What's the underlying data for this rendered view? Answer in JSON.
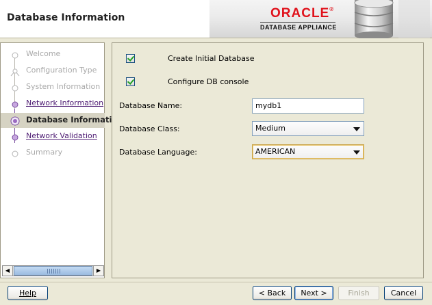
{
  "header": {
    "title": "Database Information",
    "brand": "ORACLE",
    "brand_registered": "®",
    "product": "DATABASE APPLIANCE"
  },
  "steps": [
    {
      "label": "Welcome",
      "state": "disabled"
    },
    {
      "label": "Configuration Type",
      "state": "disabled"
    },
    {
      "label": "System Information",
      "state": "disabled"
    },
    {
      "label": "Network Information",
      "state": "link"
    },
    {
      "label": "Database Information",
      "state": "current"
    },
    {
      "label": "Network Validation",
      "state": "link"
    },
    {
      "label": "Summary",
      "state": "disabled"
    }
  ],
  "form": {
    "create_initial_db": {
      "label": "Create Initial Database",
      "checked": true
    },
    "configure_console": {
      "label": "Configure DB console",
      "checked": true
    },
    "db_name": {
      "label": "Database Name:",
      "value": "mydb1"
    },
    "db_class": {
      "label": "Database Class:",
      "value": "Medium"
    },
    "db_language": {
      "label": "Database Language:",
      "value": "AMERICAN"
    }
  },
  "buttons": {
    "help": "Help",
    "back": "< Back",
    "next": "Next >",
    "finish": "Finish",
    "cancel": "Cancel"
  },
  "colors": {
    "accent_link": "#4c1a72",
    "brand_red": "#e0121b",
    "panel_bg": "#ebe9d7"
  }
}
